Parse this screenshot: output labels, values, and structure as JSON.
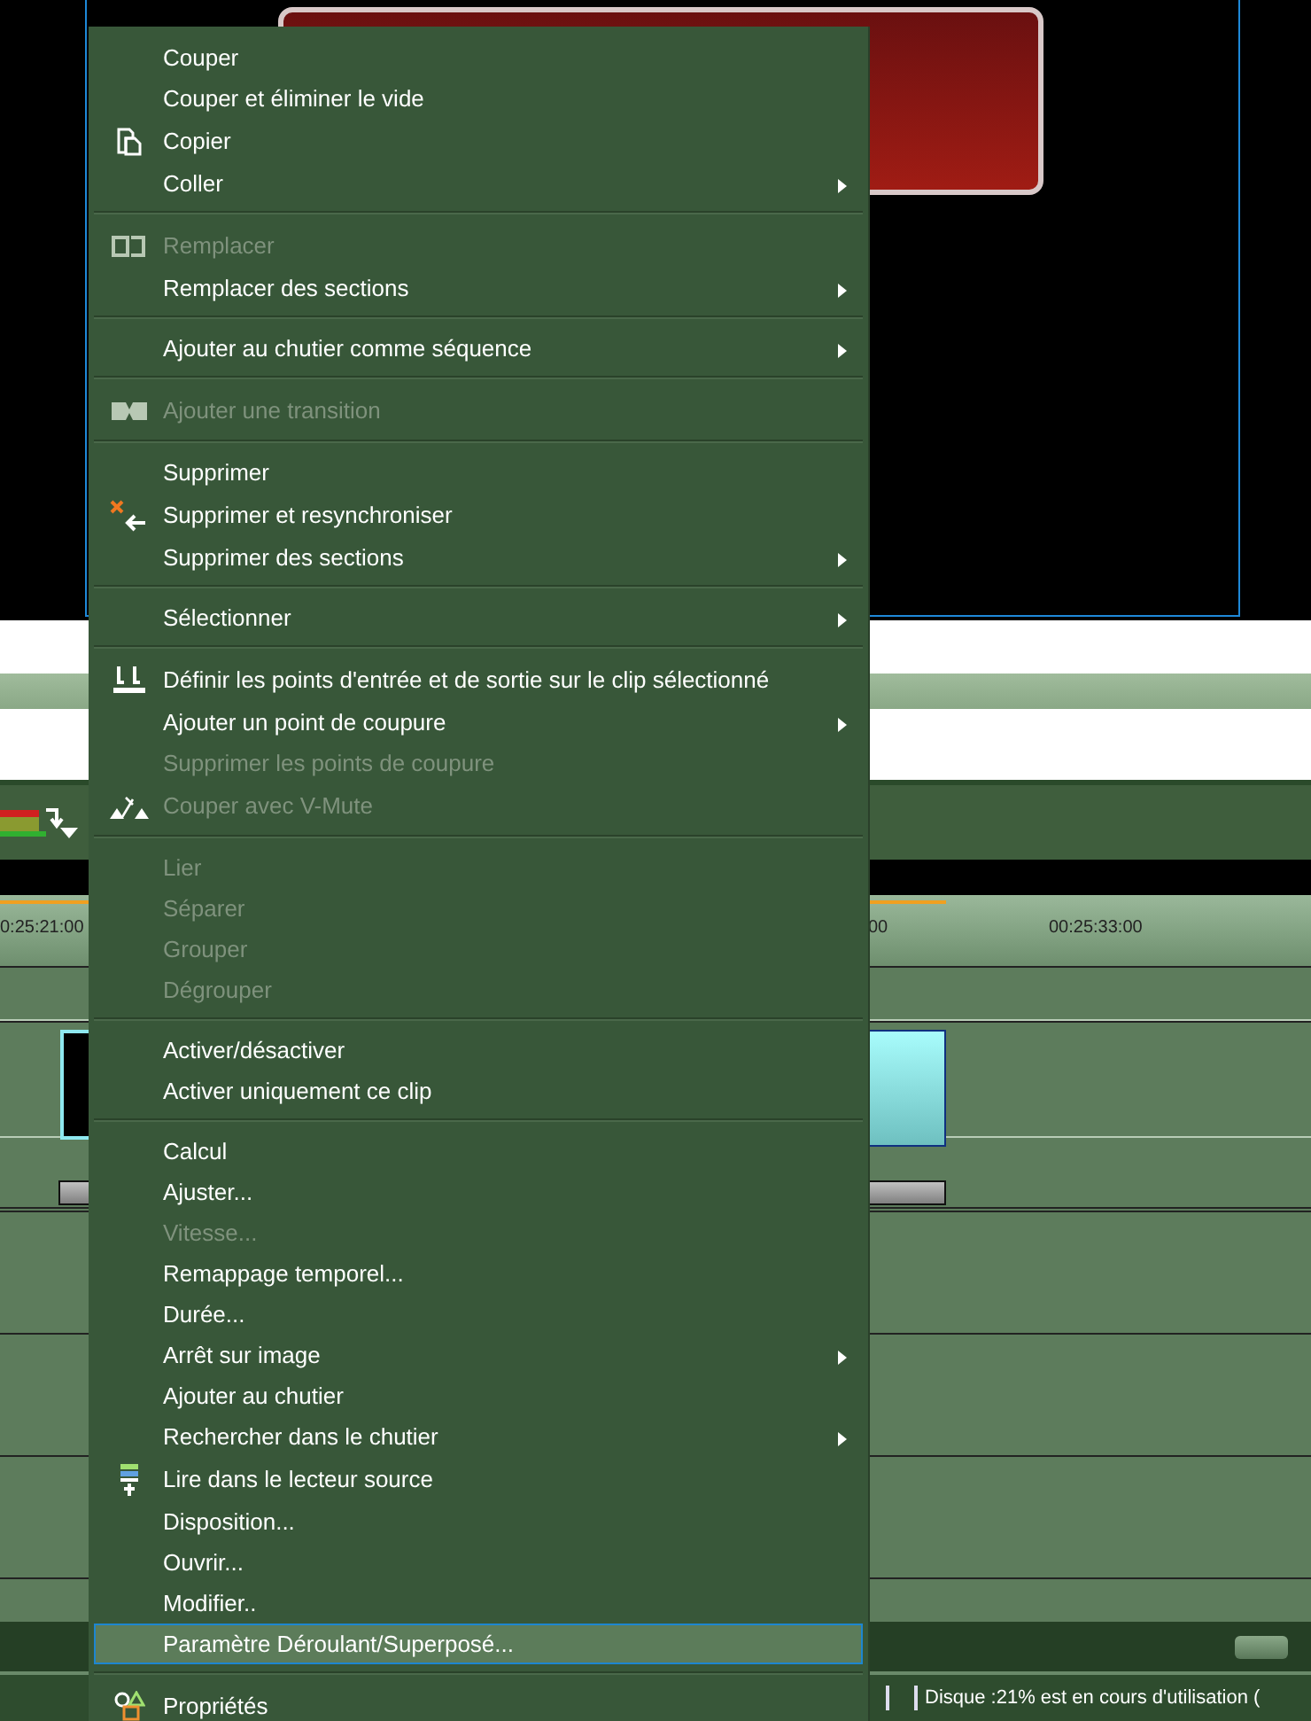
{
  "timeline": {
    "ruler": [
      {
        "label": "0:25:21:00"
      },
      {
        "label": "00"
      },
      {
        "label": "00:25:33:00"
      }
    ]
  },
  "status_bar": {
    "text": "Disque :21% est en cours d'utilisation ("
  },
  "context_menu": {
    "items": [
      {
        "kind": "item",
        "label": "Couper",
        "disabled": false,
        "submenu": false,
        "selected": false
      },
      {
        "kind": "item",
        "label": "Couper et éliminer le vide",
        "disabled": false,
        "submenu": false,
        "selected": false
      },
      {
        "kind": "copy",
        "label": "Copier",
        "disabled": false,
        "submenu": false,
        "selected": false
      },
      {
        "kind": "item",
        "label": "Coller",
        "disabled": false,
        "submenu": true,
        "selected": false
      },
      {
        "kind": "separator"
      },
      {
        "kind": "replace",
        "label": "Remplacer",
        "disabled": true,
        "submenu": false,
        "selected": false
      },
      {
        "kind": "item",
        "label": "Remplacer des sections",
        "disabled": false,
        "submenu": true,
        "selected": false
      },
      {
        "kind": "separator"
      },
      {
        "kind": "item",
        "label": "Ajouter au chutier comme séquence",
        "disabled": false,
        "submenu": true,
        "selected": false
      },
      {
        "kind": "separator"
      },
      {
        "kind": "transition",
        "label": "Ajouter une transition",
        "disabled": true,
        "submenu": false,
        "selected": false
      },
      {
        "kind": "separator"
      },
      {
        "kind": "item",
        "label": "Supprimer",
        "disabled": false,
        "submenu": false,
        "selected": false
      },
      {
        "kind": "resync",
        "label": "Supprimer et resynchroniser",
        "disabled": false,
        "submenu": false,
        "selected": false
      },
      {
        "kind": "item",
        "label": "Supprimer des sections",
        "disabled": false,
        "submenu": true,
        "selected": false
      },
      {
        "kind": "separator"
      },
      {
        "kind": "item",
        "label": "Sélectionner",
        "disabled": false,
        "submenu": true,
        "selected": false
      },
      {
        "kind": "separator"
      },
      {
        "kind": "markers",
        "label": "Définir les points d'entrée et de sortie sur le clip sélectionné",
        "disabled": false,
        "submenu": false,
        "selected": false
      },
      {
        "kind": "item",
        "label": "Ajouter un point de coupure",
        "disabled": false,
        "submenu": true,
        "selected": false
      },
      {
        "kind": "item",
        "label": "Supprimer les points de coupure",
        "disabled": true,
        "submenu": false,
        "selected": false
      },
      {
        "kind": "vmute",
        "label": "Couper avec V-Mute",
        "disabled": true,
        "submenu": false,
        "selected": false
      },
      {
        "kind": "separator"
      },
      {
        "kind": "item",
        "label": "Lier",
        "disabled": true,
        "submenu": false,
        "selected": false
      },
      {
        "kind": "item",
        "label": "Séparer",
        "disabled": true,
        "submenu": false,
        "selected": false
      },
      {
        "kind": "item",
        "label": "Grouper",
        "disabled": true,
        "submenu": false,
        "selected": false
      },
      {
        "kind": "item",
        "label": "Dégrouper",
        "disabled": true,
        "submenu": false,
        "selected": false
      },
      {
        "kind": "separator"
      },
      {
        "kind": "item",
        "label": "Activer/désactiver",
        "disabled": false,
        "submenu": false,
        "selected": false
      },
      {
        "kind": "item",
        "label": "Activer uniquement ce clip",
        "disabled": false,
        "submenu": false,
        "selected": false
      },
      {
        "kind": "separator"
      },
      {
        "kind": "item",
        "label": "Calcul",
        "disabled": false,
        "submenu": false,
        "selected": false
      },
      {
        "kind": "item",
        "label": "Ajuster...",
        "disabled": false,
        "submenu": false,
        "selected": false
      },
      {
        "kind": "item",
        "label": "Vitesse...",
        "disabled": true,
        "submenu": false,
        "selected": false
      },
      {
        "kind": "item",
        "label": "Remappage temporel...",
        "disabled": false,
        "submenu": false,
        "selected": false
      },
      {
        "kind": "item",
        "label": "Durée...",
        "disabled": false,
        "submenu": false,
        "selected": false
      },
      {
        "kind": "item",
        "label": "Arrêt sur image",
        "disabled": false,
        "submenu": true,
        "selected": false
      },
      {
        "kind": "item",
        "label": "Ajouter au chutier",
        "disabled": false,
        "submenu": false,
        "selected": false
      },
      {
        "kind": "item",
        "label": "Rechercher dans le chutier",
        "disabled": false,
        "submenu": true,
        "selected": false
      },
      {
        "kind": "source",
        "label": "Lire dans le lecteur source",
        "disabled": false,
        "submenu": false,
        "selected": false
      },
      {
        "kind": "item",
        "label": "Disposition...",
        "disabled": false,
        "submenu": false,
        "selected": false
      },
      {
        "kind": "item",
        "label": "Ouvrir...",
        "disabled": false,
        "submenu": false,
        "selected": false
      },
      {
        "kind": "item",
        "label": "Modifier..",
        "disabled": false,
        "submenu": false,
        "selected": false
      },
      {
        "kind": "item",
        "label": "Paramètre Déroulant/Superposé...",
        "disabled": false,
        "submenu": false,
        "selected": true
      },
      {
        "kind": "separator"
      },
      {
        "kind": "properties",
        "label": "Propriétés",
        "disabled": false,
        "submenu": false,
        "selected": false
      }
    ]
  }
}
